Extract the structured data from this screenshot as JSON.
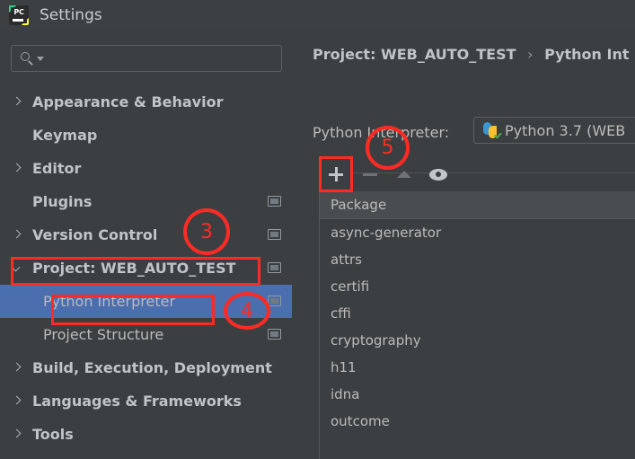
{
  "window": {
    "title": "Settings",
    "logo_icon": "pycharm-logo-icon",
    "logo_text": "PC"
  },
  "colors": {
    "panel_bg": "#3c3f41",
    "titlebar_bg": "#3c4043",
    "selection_blue": "#4b6eaf",
    "annotation_red": "#fe2b24",
    "header_bg": "#4a4d4f",
    "text": "#bbbbbb"
  },
  "sidebar": {
    "search": {
      "value": "",
      "placeholder": "",
      "icon": "search-icon",
      "dropdown_icon": "chevron-down-icon"
    },
    "items": [
      {
        "label": "Appearance & Behavior",
        "arrow": "right",
        "bold": true,
        "child": false,
        "selected": false,
        "scope_icon": false
      },
      {
        "label": "Keymap",
        "arrow": "none",
        "bold": true,
        "child": false,
        "selected": false,
        "scope_icon": false
      },
      {
        "label": "Editor",
        "arrow": "right",
        "bold": true,
        "child": false,
        "selected": false,
        "scope_icon": false
      },
      {
        "label": "Plugins",
        "arrow": "none",
        "bold": true,
        "child": false,
        "selected": false,
        "scope_icon": true
      },
      {
        "label": "Version Control",
        "arrow": "right",
        "bold": true,
        "child": false,
        "selected": false,
        "scope_icon": true
      },
      {
        "label": "Project: WEB_AUTO_TEST",
        "arrow": "down",
        "bold": true,
        "child": false,
        "selected": false,
        "scope_icon": true
      },
      {
        "label": "Python Interpreter",
        "arrow": "none",
        "bold": false,
        "child": true,
        "selected": true,
        "scope_icon": true
      },
      {
        "label": "Project Structure",
        "arrow": "none",
        "bold": false,
        "child": true,
        "selected": false,
        "scope_icon": true
      },
      {
        "label": "Build, Execution, Deployment",
        "arrow": "right",
        "bold": true,
        "child": false,
        "selected": false,
        "scope_icon": false
      },
      {
        "label": "Languages & Frameworks",
        "arrow": "right",
        "bold": true,
        "child": false,
        "selected": false,
        "scope_icon": false
      },
      {
        "label": "Tools",
        "arrow": "right",
        "bold": true,
        "child": false,
        "selected": false,
        "scope_icon": false
      }
    ]
  },
  "main": {
    "breadcrumb": {
      "root": "Project: WEB_AUTO_TEST",
      "separator": "›",
      "leaf": "Python Int"
    },
    "interpreter": {
      "label": "Python Interpreter:",
      "value": "Python 3.7 (WEB",
      "icon": "python-logo-icon"
    },
    "toolbar": {
      "add": "+",
      "add_icon": "plus-icon",
      "remove_icon": "minus-icon",
      "upgrade_icon": "triangle-up-icon",
      "show_early_releases_icon": "eye-icon"
    },
    "packages_table": {
      "columns": [
        "Package"
      ],
      "rows": [
        "async-generator",
        "attrs",
        "certifi",
        "cffi",
        "cryptography",
        "h11",
        "idna",
        "outcome"
      ]
    }
  },
  "annotations": {
    "circles": [
      {
        "id": "3",
        "label": "3"
      },
      {
        "id": "4",
        "label": "4"
      },
      {
        "id": "5",
        "label": "5"
      }
    ],
    "boxes": [
      {
        "id": "project-row"
      },
      {
        "id": "python-interpreter-row"
      },
      {
        "id": "add-package-button"
      }
    ]
  }
}
